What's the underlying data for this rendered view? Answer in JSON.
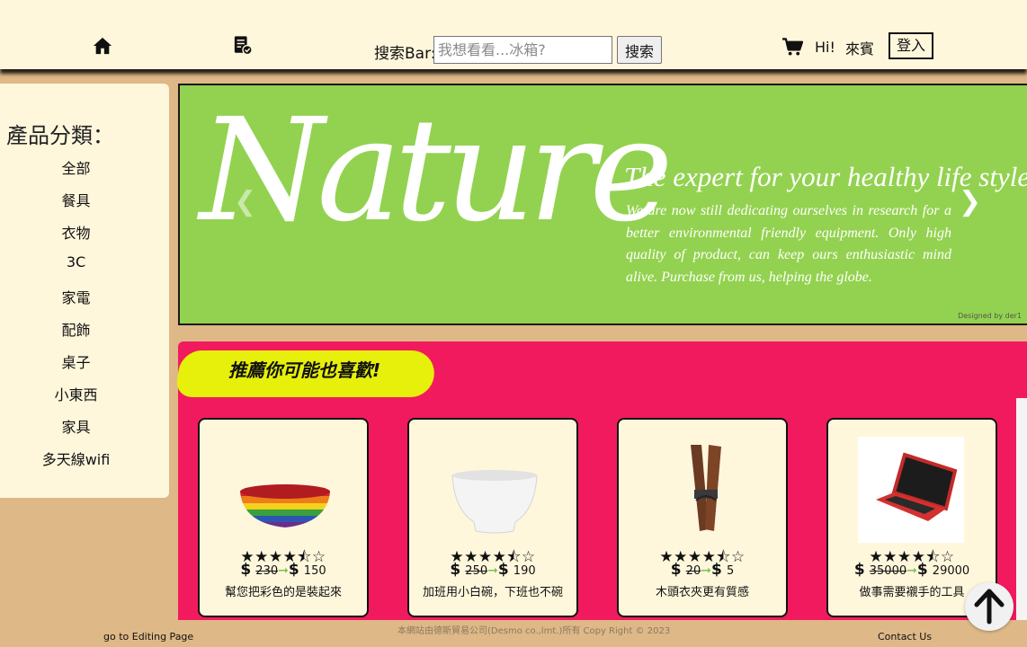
{
  "header": {
    "icons": {
      "home": "home-icon",
      "orders": "receipt-check-icon",
      "cart": "cart-icon"
    },
    "search_label": "搜索Bar:",
    "search_placeholder": "我想看看...冰箱?",
    "search_value": "",
    "search_button": "搜索",
    "greeting": "Hi!",
    "user_name": "來賓",
    "login_button": "登入"
  },
  "sidebar": {
    "title": "產品分類：",
    "categories": [
      "全部",
      "餐具",
      "衣物",
      "3C",
      "家電",
      "配飾",
      "桌子",
      "小東西",
      "家具",
      "多天線wifi"
    ]
  },
  "banner": {
    "title": "Nature",
    "subtitle": "The expert for your healthy life style",
    "text": "We are now still  dedicating ourselves in research for a better environmental friendly equipment. Only high quality of product, can keep ours enthusiastic mind alive. Purchase from us, helping the globe.",
    "credit": "Designed by der1",
    "prev_icon": "chevron-left-icon",
    "next_icon": "chevron-right-icon"
  },
  "recommend": {
    "title": "推薦你可能也喜歡!",
    "products": [
      {
        "image": "rainbow-bowl",
        "rating": 3.5,
        "currency": "$",
        "old_price": "230",
        "new_price": "150",
        "description": "幫您把彩色的是裝起來"
      },
      {
        "image": "white-bowl",
        "rating": 3.5,
        "currency": "$",
        "old_price": "250",
        "new_price": "190",
        "description": "加班用小白碗，下班也不碗"
      },
      {
        "image": "wooden-clothespin",
        "rating": 3.5,
        "currency": "$",
        "old_price": "20",
        "new_price": "5",
        "description": "木頭衣夾更有質感"
      },
      {
        "image": "red-laptop",
        "rating": 3.5,
        "currency": "$",
        "old_price": "35000",
        "new_price": "29000",
        "description": "做事需要襯手的工具"
      }
    ]
  },
  "footer": {
    "edit_link": "go to Editing Page",
    "copyright": "本網站由德斯貿易公司(Desmo co.,lmt.)所有 Copy Right © 2023",
    "contact_link": "Contact Us"
  },
  "scroll_top_icon": "arrow-up-icon",
  "colors": {
    "header_bg": "#fff7dc",
    "page_bg": "#deb887",
    "banner_bg": "#93d250",
    "section_bg": "#f21a5e",
    "tag_bg": "#e6f00a",
    "price_arrow": "#79c24a"
  }
}
